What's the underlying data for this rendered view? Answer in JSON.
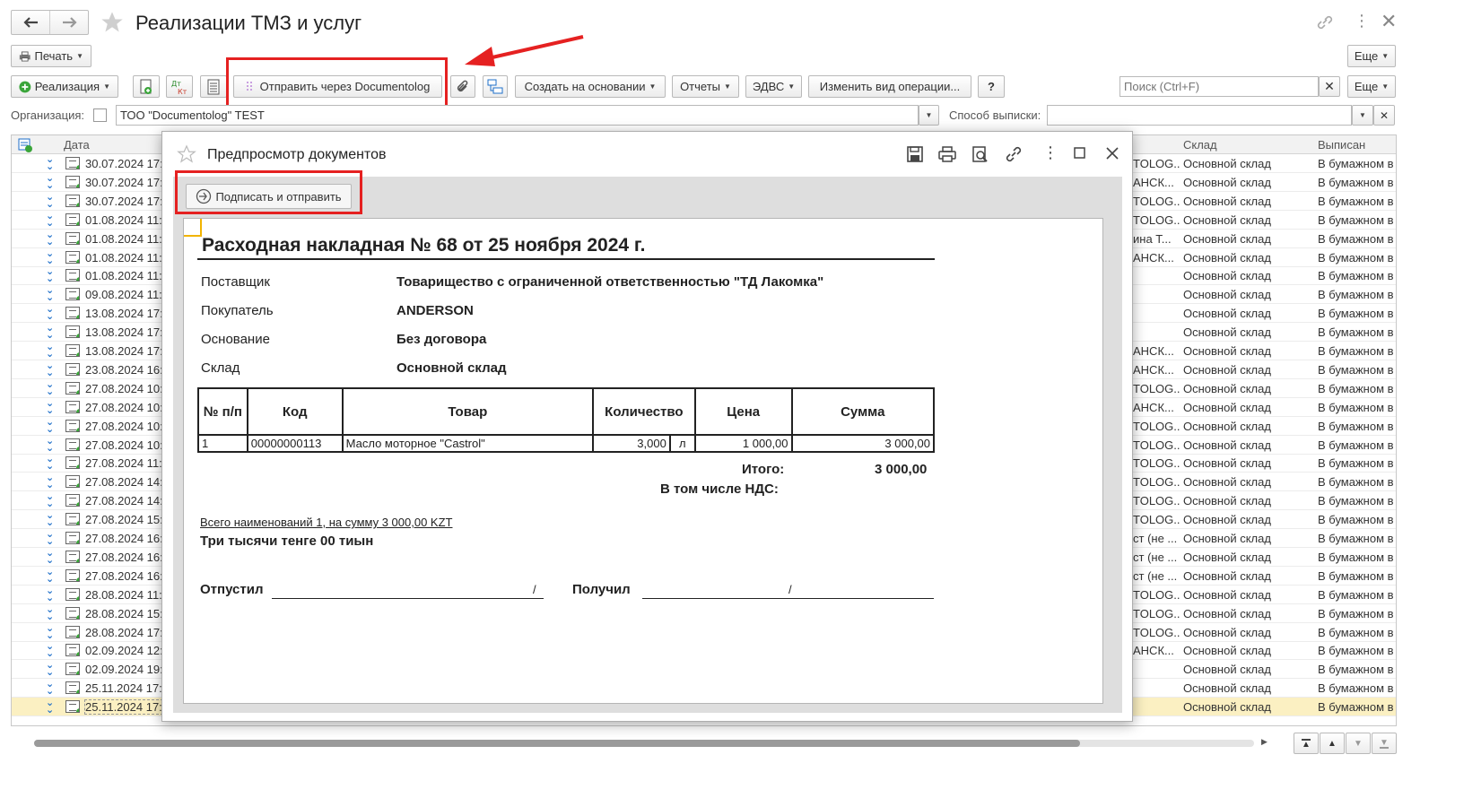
{
  "window": {
    "title": "Реализации ТМЗ и услуг"
  },
  "toolbar1": {
    "print_label": "Печать",
    "more_label": "Еще"
  },
  "toolbar2": {
    "realization_label": "Реализация",
    "send_label": "Отправить через Documentolog",
    "create_basis_label": "Создать на основании",
    "reports_label": "Отчеты",
    "edvs_label": "ЭДВС",
    "change_op_label": "Изменить вид операции...",
    "help_label": "?",
    "search_placeholder": "Поиск (Ctrl+F)",
    "more_label": "Еще"
  },
  "filters": {
    "org_label": "Организация:",
    "org_value": "ТОО \"Documentolog\" TEST",
    "method_label": "Способ выписки:",
    "method_value": ""
  },
  "list": {
    "columns": {
      "date": "Дата",
      "warehouse": "Склад",
      "issued": "Выписан"
    },
    "rows": [
      {
        "date": "30.07.2024 17:1",
        "counterparty": "TOLOG...",
        "warehouse": "Основной склад",
        "issued": "В бумажном в"
      },
      {
        "date": "30.07.2024 17:2",
        "counterparty": "АНСК...",
        "warehouse": "Основной склад",
        "issued": "В бумажном в"
      },
      {
        "date": "30.07.2024 17:2",
        "counterparty": "TOLOG...",
        "warehouse": "Основной склад",
        "issued": "В бумажном в"
      },
      {
        "date": "01.08.2024 11:4",
        "counterparty": "TOLOG...",
        "warehouse": "Основной склад",
        "issued": "В бумажном в"
      },
      {
        "date": "01.08.2024 11:5",
        "counterparty": "ина Т...",
        "warehouse": "Основной склад",
        "issued": "В бумажном в"
      },
      {
        "date": "01.08.2024 11:5",
        "counterparty": "АНСК...",
        "warehouse": "Основной склад",
        "issued": "В бумажном в"
      },
      {
        "date": "01.08.2024 11:5",
        "counterparty": "",
        "warehouse": "Основной склад",
        "issued": "В бумажном в"
      },
      {
        "date": "09.08.2024 11:1",
        "counterparty": "",
        "warehouse": "Основной склад",
        "issued": "В бумажном в"
      },
      {
        "date": "13.08.2024 17:2",
        "counterparty": "",
        "warehouse": "Основной склад",
        "issued": "В бумажном в"
      },
      {
        "date": "13.08.2024 17:2",
        "counterparty": "",
        "warehouse": "Основной склад",
        "issued": "В бумажном в"
      },
      {
        "date": "13.08.2024 17:2",
        "counterparty": "АНСК...",
        "warehouse": "Основной склад",
        "issued": "В бумажном в"
      },
      {
        "date": "23.08.2024 16:5",
        "counterparty": "АНСК...",
        "warehouse": "Основной склад",
        "issued": "В бумажном в"
      },
      {
        "date": "27.08.2024 10:3",
        "counterparty": "TOLOG...",
        "warehouse": "Основной склад",
        "issued": "В бумажном в"
      },
      {
        "date": "27.08.2024 10:4",
        "counterparty": "АНСК...",
        "warehouse": "Основной склад",
        "issued": "В бумажном в"
      },
      {
        "date": "27.08.2024 10:4",
        "counterparty": "TOLOG...",
        "warehouse": "Основной склад",
        "issued": "В бумажном в"
      },
      {
        "date": "27.08.2024 10:5",
        "counterparty": "TOLOG...",
        "warehouse": "Основной склад",
        "issued": "В бумажном в"
      },
      {
        "date": "27.08.2024 11:0",
        "counterparty": "TOLOG...",
        "warehouse": "Основной склад",
        "issued": "В бумажном в"
      },
      {
        "date": "27.08.2024 14:4",
        "counterparty": "TOLOG...",
        "warehouse": "Основной склад",
        "issued": "В бумажном в"
      },
      {
        "date": "27.08.2024 14:5",
        "counterparty": "TOLOG...",
        "warehouse": "Основной склад",
        "issued": "В бумажном в"
      },
      {
        "date": "27.08.2024 15:0",
        "counterparty": "TOLOG...",
        "warehouse": "Основной склад",
        "issued": "В бумажном в"
      },
      {
        "date": "27.08.2024 16:1",
        "counterparty": "ст (не ...",
        "warehouse": "Основной склад",
        "issued": "В бумажном в"
      },
      {
        "date": "27.08.2024 16:3",
        "counterparty": "ст (не ...",
        "warehouse": "Основной склад",
        "issued": "В бумажном в"
      },
      {
        "date": "27.08.2024 16:4",
        "counterparty": "ст (не ...",
        "warehouse": "Основной склад",
        "issued": "В бумажном в"
      },
      {
        "date": "28.08.2024 11:0",
        "counterparty": "TOLOG...",
        "warehouse": "Основной склад",
        "issued": "В бумажном в"
      },
      {
        "date": "28.08.2024 15:3",
        "counterparty": "TOLOG...",
        "warehouse": "Основной склад",
        "issued": "В бумажном в"
      },
      {
        "date": "28.08.2024 17:3",
        "counterparty": "TOLOG...",
        "warehouse": "Основной склад",
        "issued": "В бумажном в"
      },
      {
        "date": "02.09.2024 12:0",
        "counterparty": "АНСК...",
        "warehouse": "Основной склад",
        "issued": "В бумажном в"
      },
      {
        "date": "02.09.2024 19:3",
        "counterparty": "",
        "warehouse": "Основной склад",
        "issued": "В бумажном в"
      },
      {
        "date": "25.11.2024 17:2",
        "counterparty": "",
        "warehouse": "Основной склад",
        "issued": "В бумажном в"
      },
      {
        "date": "25.11.2024 17:2",
        "counterparty": "",
        "warehouse": "Основной склад",
        "issued": "В бумажном в",
        "selected": true
      }
    ]
  },
  "modal": {
    "title": "Предпросмотр документов",
    "sign_send_label": "Подписать и отправить",
    "doc": {
      "heading": "Расходная накладная № 68 от 25 ноября 2024 г.",
      "supplier_label": "Поставщик",
      "supplier_value": "Товарищество с ограниченной ответственностью \"ТД Лакомка\"",
      "buyer_label": "Покупатель",
      "buyer_value": "ANDERSON",
      "basis_label": "Основание",
      "basis_value": "Без договора",
      "warehouse_label": "Склад",
      "warehouse_value": "Основной склад",
      "table_headers": [
        "№ п/п",
        "Код",
        "Товар",
        "Количество",
        "Цена",
        "Сумма"
      ],
      "table_row": {
        "num": "1",
        "code": "00000000113",
        "product": "Масло моторное \"Castrol\"",
        "qty": "3,000",
        "unit": "л",
        "price": "1 000,00",
        "sum": "3 000,00"
      },
      "total_label": "Итого:",
      "total_value": "3 000,00",
      "vat_label": "В том числе НДС:",
      "summary_line": "Всего наименований 1, на сумму 3 000,00 KZT",
      "amount_words": "Три тысячи тенге 00 тиын",
      "released_label": "Отпустил",
      "received_label": "Получил",
      "slash": "/"
    }
  },
  "colors": {
    "highlight_red": "#e52121",
    "selected_row": "#fbf0c2",
    "accent_green": "#3aa53a",
    "accent_blue": "#1d6fc9"
  }
}
